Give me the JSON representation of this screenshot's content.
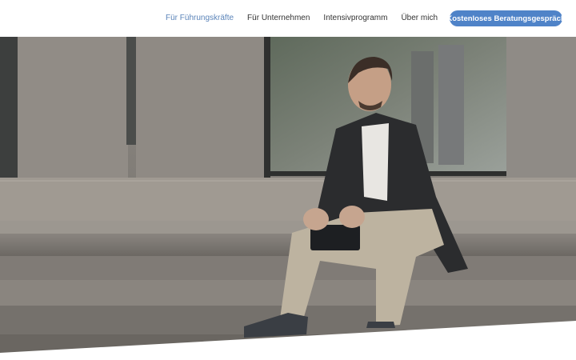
{
  "nav": {
    "items": [
      {
        "label": "Für Führungskräfte",
        "active": true
      },
      {
        "label": "Für Unternehmen",
        "active": false
      },
      {
        "label": "Intensivprogramm",
        "active": false
      },
      {
        "label": "Über mich",
        "active": false
      }
    ],
    "cta_label": "Kostenloses Beratungsgespräch"
  },
  "colors": {
    "accent": "#4f83c8",
    "nav_active": "#5b84b9",
    "nav_text": "#333333"
  }
}
